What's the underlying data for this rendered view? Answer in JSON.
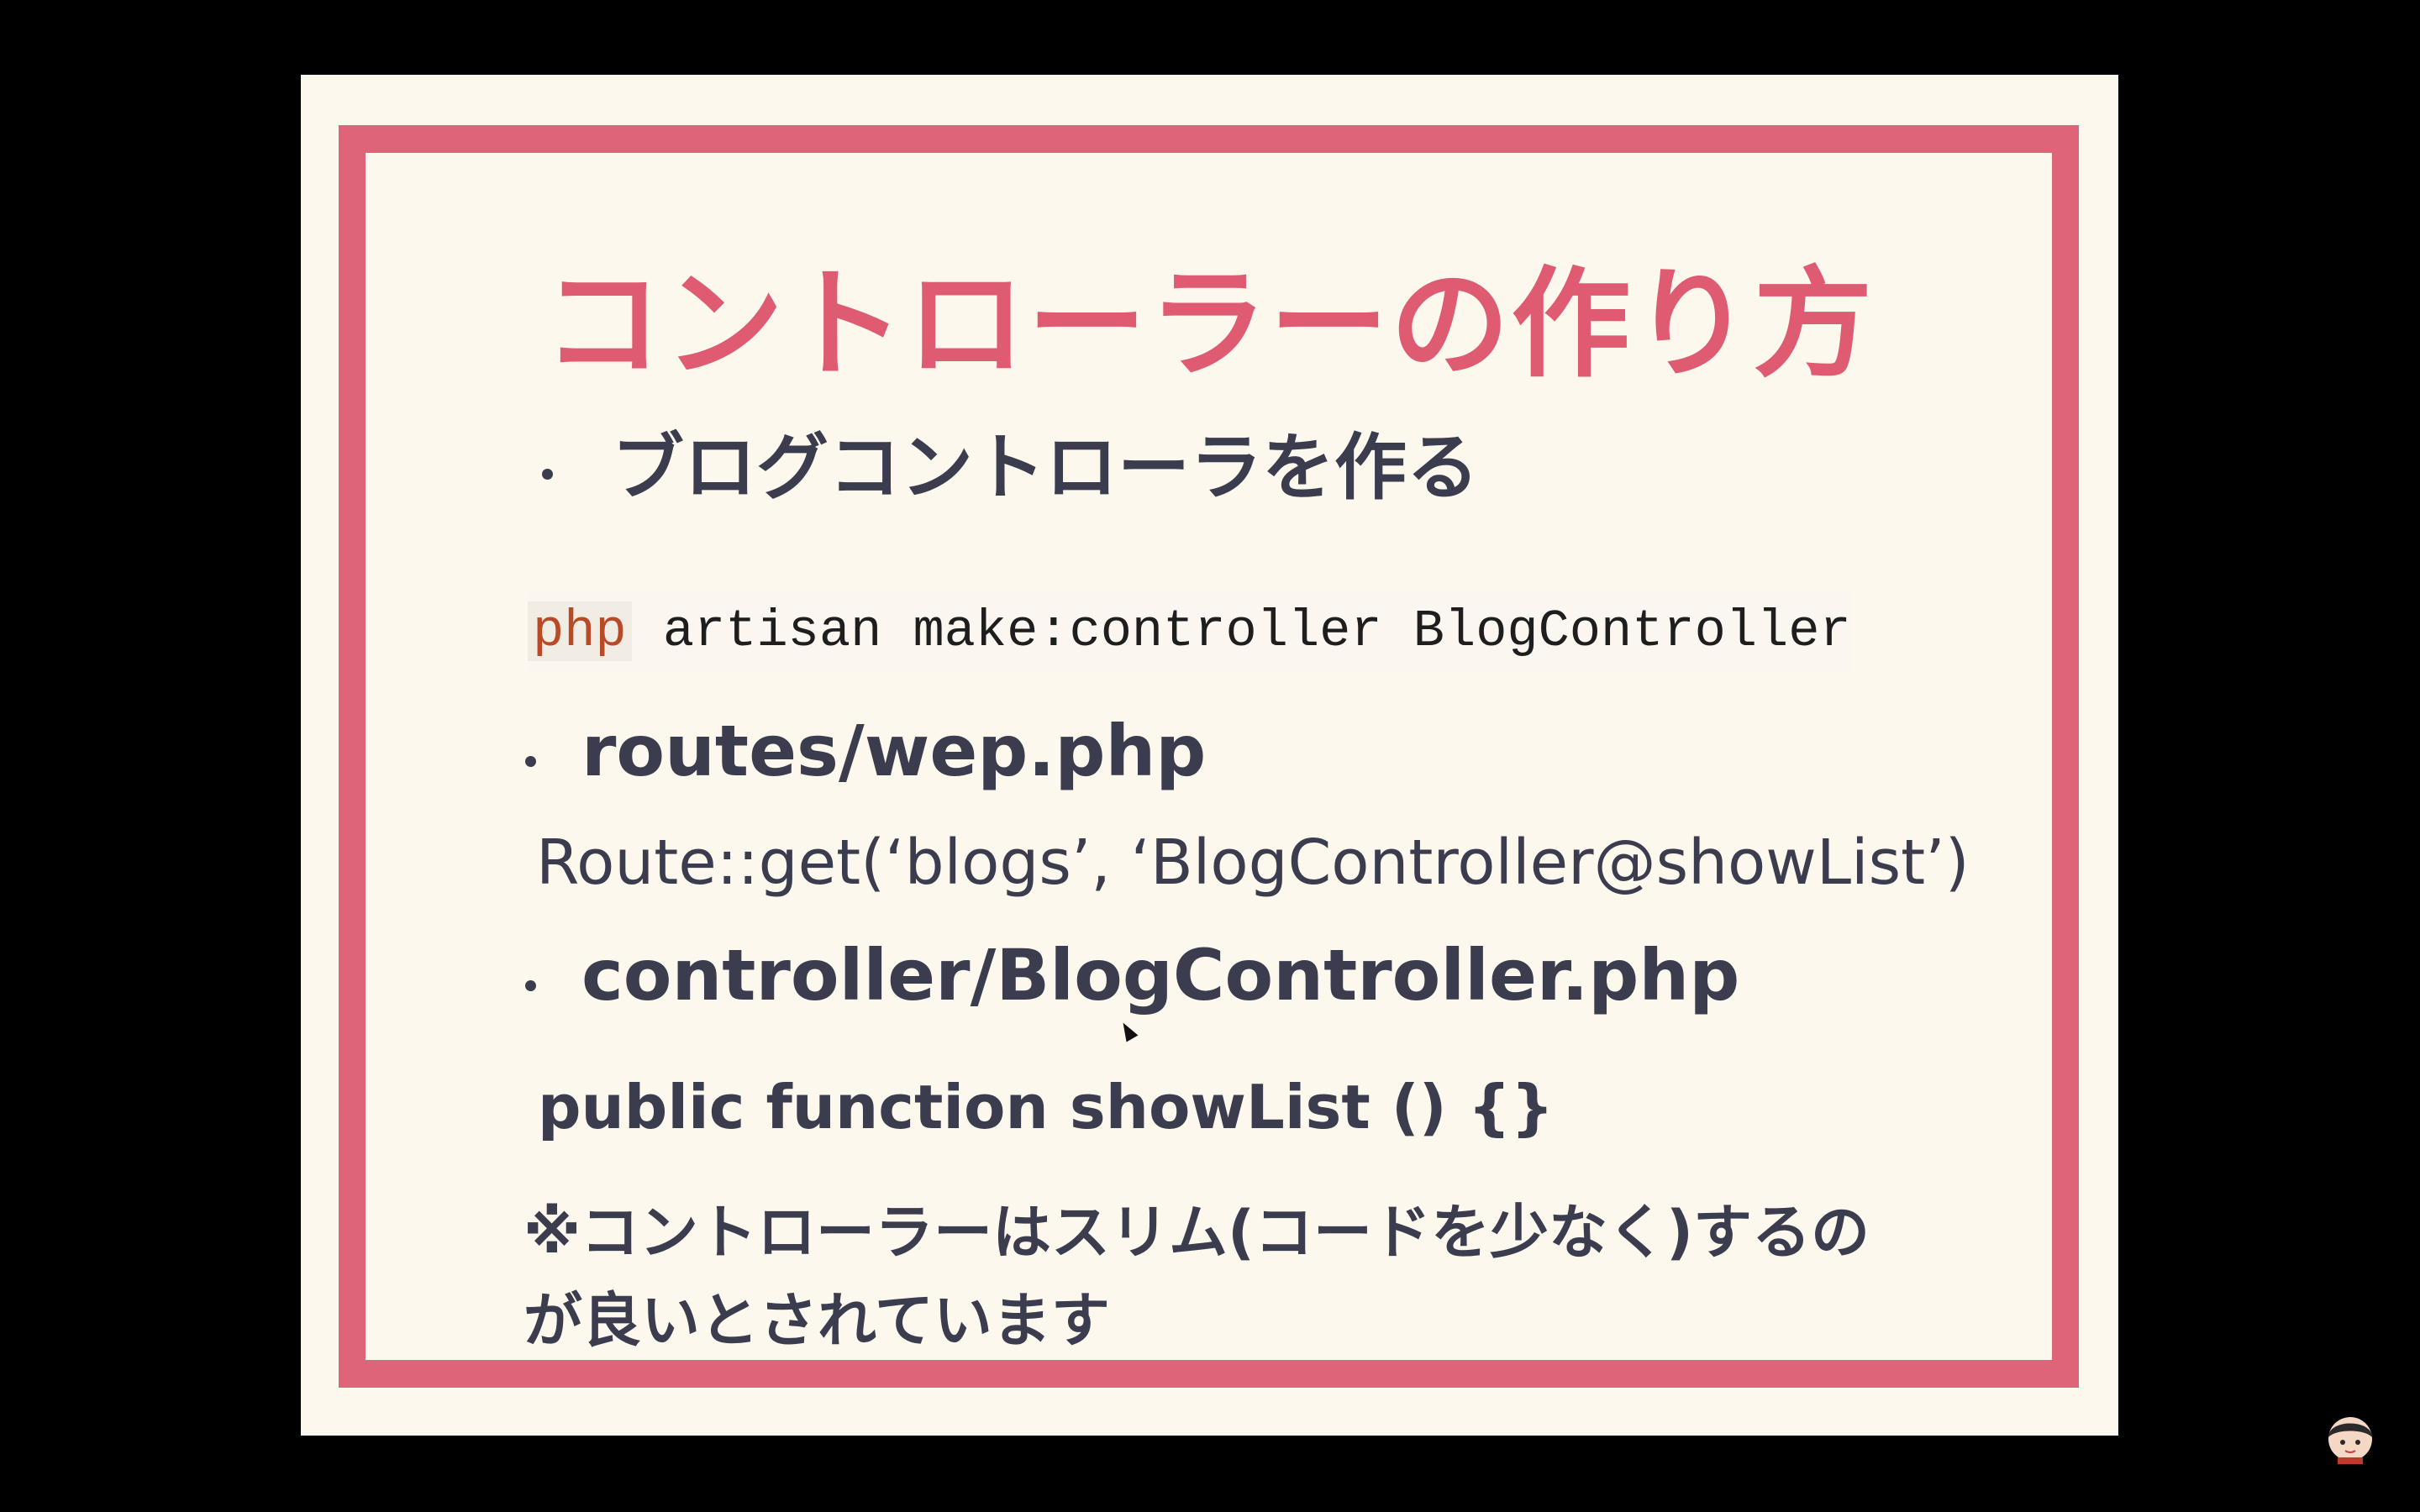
{
  "slide": {
    "title": "コントローラーの作り方",
    "bullet1": "ブログコントローラを作る",
    "code_keyword": "php",
    "code_rest": " artisan make:controller BlogController",
    "bullet2": "routes/wep.php",
    "route_line": "Route::get(‘blogs’, ‘BlogController@showList’)",
    "bullet3": "controller/BlogController.php",
    "function_line": "public function showList () {}",
    "note_line1": "※コントローラーはスリム(コードを少なく)するの",
    "note_line2": "が良いとされています"
  },
  "colors": {
    "background": "#000000",
    "slide_bg": "#fdf8ee",
    "frame": "#de6479",
    "title": "#de5b72",
    "text": "#3b3d4f",
    "code_keyword": "#b84a27"
  },
  "icons": {
    "cursor": "mouse-pointer-icon",
    "avatar": "presenter-avatar-icon"
  }
}
